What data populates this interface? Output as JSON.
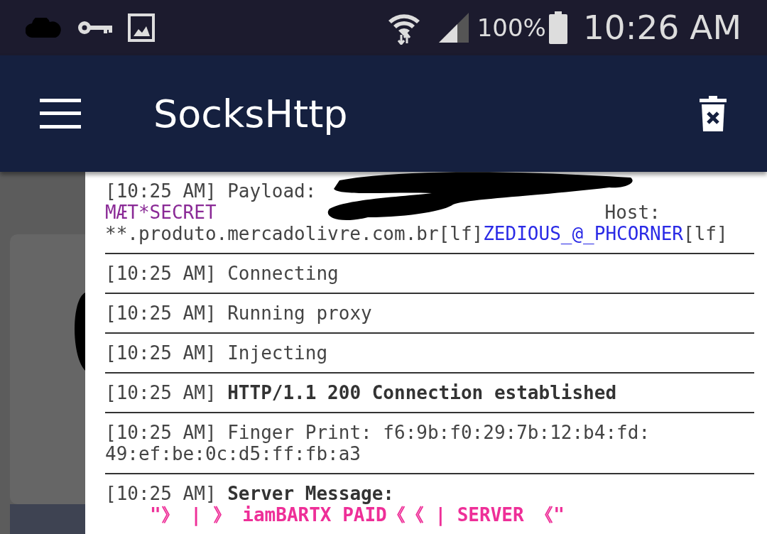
{
  "status_bar": {
    "battery": "100%",
    "time": "10:26 AM"
  },
  "app_bar": {
    "title": "SocksHttp"
  },
  "log": [
    {
      "kind": "payload",
      "time": "[10:25 AM]",
      "label": "Payload:",
      "secret": "MÆT*SECRET",
      "host_label": "Host:",
      "host": "**.produto.mercadolivre.com.br[lf]",
      "tag": "ZEDIOUS_@_PHCORNER",
      "tail": "[lf]"
    },
    {
      "kind": "plain",
      "time": "[10:25 AM]",
      "lines": [
        "Connecting"
      ]
    },
    {
      "kind": "plain",
      "time": "[10:25 AM]",
      "lines": [
        "Running proxy"
      ]
    },
    {
      "kind": "plain",
      "time": "[10:25 AM]",
      "lines": [
        "Injecting"
      ]
    },
    {
      "kind": "bold",
      "time": "[10:25 AM]",
      "lines": [
        "HTTP/1.1 200 Connection established"
      ]
    },
    {
      "kind": "plain",
      "time": "[10:25 AM]",
      "lines": [
        "Finger Print: f6:9b:f0:29:7b:12:b4:fd:",
        "49:ef:be:0c:d5:ff:fb:a3"
      ]
    },
    {
      "kind": "server",
      "time": "[10:25 AM]",
      "label": "Server Message:",
      "message": "\"》 | 》 iamBARTX PAID《《 | SERVER 《\""
    }
  ]
}
